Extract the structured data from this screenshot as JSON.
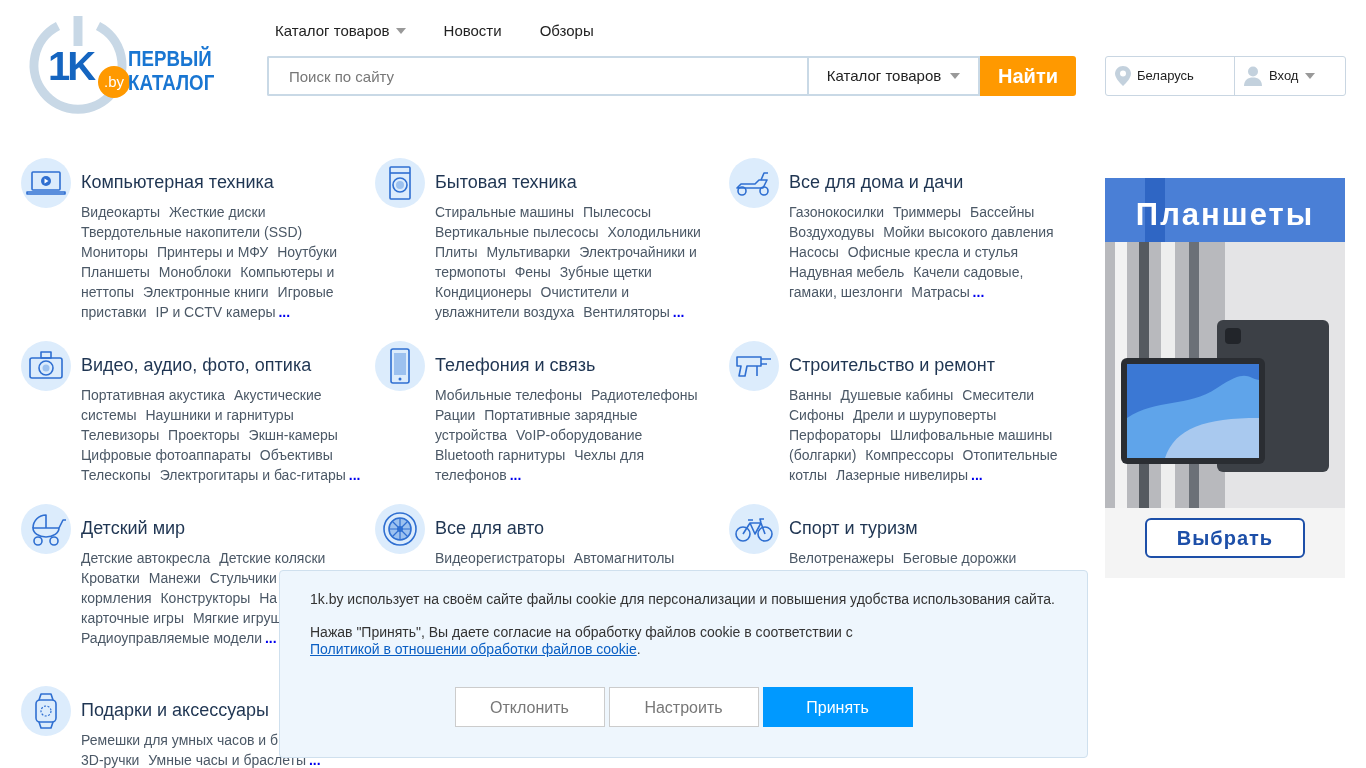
{
  "header": {
    "logo": {
      "number": "1K",
      "domain": ".by",
      "line1": "ПЕРВЫЙ",
      "line2": "КАТАЛОГ"
    },
    "nav": [
      {
        "label": "Каталог товаров",
        "dropdown": true
      },
      {
        "label": "Новости",
        "dropdown": false
      },
      {
        "label": "Обзоры",
        "dropdown": false
      }
    ],
    "search": {
      "placeholder": "Поиск по сайту",
      "scope": "Каталог товаров",
      "button": "Найти"
    },
    "location": "Беларусь",
    "login": "Вход"
  },
  "categories": [
    {
      "title": "Компьютерная техника",
      "lines": [
        [
          "Видеокарты",
          "Жесткие диски"
        ],
        [
          "Твердотельные накопители (SSD)"
        ],
        [
          "Мониторы",
          "Принтеры и МФУ",
          "Ноутбуки"
        ],
        [
          "Планшеты",
          "Моноблоки",
          "Компьютеры и"
        ],
        [
          "неттопы",
          "Электронные книги",
          "Игровые"
        ],
        [
          "приставки",
          "IP и CCTV камеры"
        ]
      ],
      "more": "..."
    },
    {
      "title": "Бытовая техника",
      "lines": [
        [
          "Стиральные машины",
          "Пылесосы"
        ],
        [
          "Вертикальные пылесосы",
          "Холодильники"
        ],
        [
          "Плиты",
          "Мультиварки",
          "Электрочайники и"
        ],
        [
          "термопоты",
          "Фены",
          "Зубные щетки"
        ],
        [
          "Кондиционеры",
          "Очистители и"
        ],
        [
          "увлажнители воздуха",
          "Вентиляторы"
        ]
      ],
      "more": "..."
    },
    {
      "title": "Все для дома и дачи",
      "lines": [
        [
          "Газонокосилки",
          "Триммеры",
          "Бассейны"
        ],
        [
          "Воздуходувы",
          "Мойки высокого давления"
        ],
        [
          "Насосы",
          "Офисные кресла и стулья"
        ],
        [
          "Надувная мебель",
          "Качели садовые,"
        ],
        [
          "гамаки, шезлонги",
          "Матрасы"
        ]
      ],
      "more": "..."
    },
    {
      "title": "Видео, аудио, фото, оптика",
      "lines": [
        [
          "Портативная акустика",
          "Акустические"
        ],
        [
          "системы",
          "Наушники и гарнитуры"
        ],
        [
          "Телевизоры",
          "Проекторы",
          "Экшн-камеры"
        ],
        [
          "Цифровые фотоаппараты",
          "Объективы"
        ],
        [
          "Телескопы",
          "Электрогитары и бас-гитары"
        ]
      ],
      "more": "..."
    },
    {
      "title": "Телефония и связь",
      "lines": [
        [
          "Мобильные телефоны",
          "Радиотелефоны"
        ],
        [
          "Рации",
          "Портативные зарядные"
        ],
        [
          "устройства",
          "VoIP-оборудование"
        ],
        [
          "Bluetooth гарнитуры",
          "Чехлы для"
        ],
        [
          "телефонов"
        ]
      ],
      "more": "..."
    },
    {
      "title": "Строительство и ремонт",
      "lines": [
        [
          "Ванны",
          "Душевые кабины",
          "Смесители"
        ],
        [
          "Сифоны",
          "Дрели и шуруповерты"
        ],
        [
          "Перфораторы",
          "Шлифовальные машины"
        ],
        [
          "(болгарки)",
          "Компрессоры",
          "Отопительные"
        ],
        [
          "котлы",
          "Лазерные нивелиры"
        ]
      ],
      "more": "..."
    },
    {
      "title": "Детский мир",
      "lines": [
        [
          "Детские автокресла",
          "Детские коляски"
        ],
        [
          "Кроватки",
          "Манежи",
          "Стульчики"
        ],
        [
          "кормления",
          "Конструкторы",
          "На"
        ],
        [
          "карточные игры",
          "Мягкие игруш"
        ],
        [
          "Радиоуправляемые модели"
        ]
      ],
      "more": "..."
    },
    {
      "title": "Все для авто",
      "lines": [
        [
          "Видеорегистраторы",
          "Автомагнитолы"
        ]
      ]
    },
    {
      "title": "Спорт и туризм",
      "lines": [
        [
          "Велотренажеры",
          "Беговые дорожки"
        ]
      ]
    },
    {
      "title": "Подарки и аксессуары",
      "lines": [
        [
          "Ремешки для умных часов и б"
        ],
        [
          "3D-ручки",
          "Умные часы и браслеты"
        ]
      ],
      "more": "..."
    }
  ],
  "banner": {
    "title": "Планшеты",
    "button": "Выбрать"
  },
  "cookie_notice": {
    "text": "1k.by использует на своём сайте файлы cookie для персонализации и повышения удобства использования сайта.",
    "consent": "Нажав \"Принять\", Вы даете согласие на обработку файлов cookie в соответствии с",
    "link": "Политикой в отношении обработки файлов cookie",
    "after": ".",
    "buttons": [
      {
        "label": "Отклонить",
        "kind": "secondary"
      },
      {
        "label": "Настроить",
        "kind": "secondary"
      },
      {
        "label": "Принять",
        "kind": "primary"
      }
    ]
  }
}
